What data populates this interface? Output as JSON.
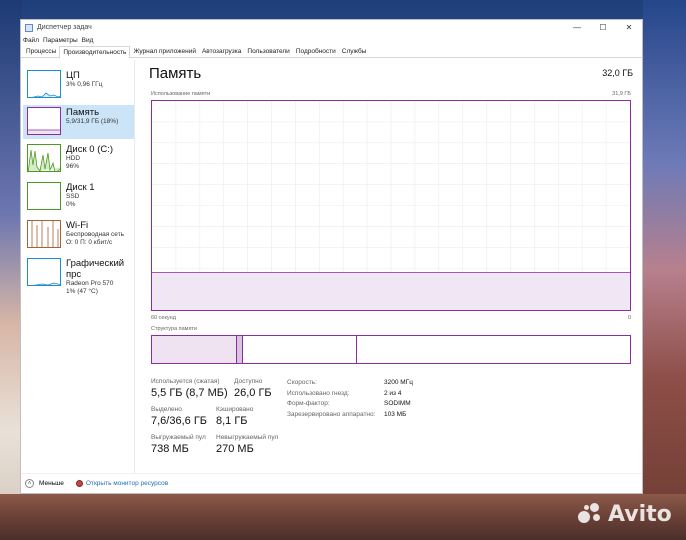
{
  "window": {
    "title": "Диспетчер задач",
    "minimize_icon": "minimize-icon",
    "maximize_icon": "maximize-icon",
    "close_icon": "close-icon"
  },
  "menu": [
    "Файл",
    "Параметры",
    "Вид"
  ],
  "tabs": [
    "Процессы",
    "Производительность",
    "Журнал приложений",
    "Автозагрузка",
    "Пользователи",
    "Подробности",
    "Службы"
  ],
  "active_tab": "Производительность",
  "sidebar": {
    "items": [
      {
        "name": "ЦП",
        "line1": "3%  0,96 ГГц",
        "line2": "",
        "color": "#1b8fd1",
        "icon": "cpu-graph"
      },
      {
        "name": "Память",
        "line1": "5,9/31,9 ГБ (18%)",
        "line2": "",
        "color": "#8b2c9f",
        "icon": "memory-graph"
      },
      {
        "name": "Диск 0 (C:)",
        "line1": "HDD",
        "line2": "96%",
        "color": "#4b9a23",
        "icon": "disk-graph"
      },
      {
        "name": "Диск 1",
        "line1": "SSD",
        "line2": "0%",
        "color": "#4b9a23",
        "icon": "disk-graph"
      },
      {
        "name": "Wi-Fi",
        "line1": "Беспроводная сеть",
        "line2": "О: 0  П: 0 кбит/с",
        "color": "#a86132",
        "icon": "network-graph"
      },
      {
        "name": "Графический прс",
        "line1": "Radeon Pro 570",
        "line2": "1% (47 °C)",
        "color": "#1b8fd1",
        "icon": "gpu-graph"
      }
    ]
  },
  "main": {
    "title": "Память",
    "total": "32,0 ГБ",
    "usage_label": "Использование памяти",
    "usage_max": "31,9 ГБ",
    "time_left": "60 секунд",
    "time_right": "0",
    "structure_label": "Структура памяти",
    "stats": {
      "in_use_label": "Используется (сжатая)",
      "in_use_value": "5,5 ГБ (8,7 МБ)",
      "available_label": "Доступно",
      "available_value": "26,0 ГБ",
      "committed_label": "Выделено",
      "committed_value": "7,6/36,6 ГБ",
      "cached_label": "Кэшировано",
      "cached_value": "8,1 ГБ",
      "paged_label": "Выгружаемый пул",
      "paged_value": "738 МБ",
      "nonpaged_label": "Невыгружаемый пул",
      "nonpaged_value": "270 МБ"
    },
    "properties": [
      {
        "key": "Скорость:",
        "value": "3200 МГц"
      },
      {
        "key": "Использовано гнезд:",
        "value": "2 из 4"
      },
      {
        "key": "Форм-фактор:",
        "value": "SODIMM"
      },
      {
        "key": "Зарезервировано аппаратно:",
        "value": "103 МБ"
      }
    ],
    "graph": {
      "usage_fraction": 0.18
    }
  },
  "footer": {
    "fewer_label": "Меньше",
    "monitor_label": "Открыть монитор ресурсов"
  },
  "accent_colors": {
    "memory": "#8b2c9f",
    "cpu": "#1b8fd1",
    "disk": "#4b9a23",
    "wifi": "#a86132"
  },
  "watermark": "Avito"
}
